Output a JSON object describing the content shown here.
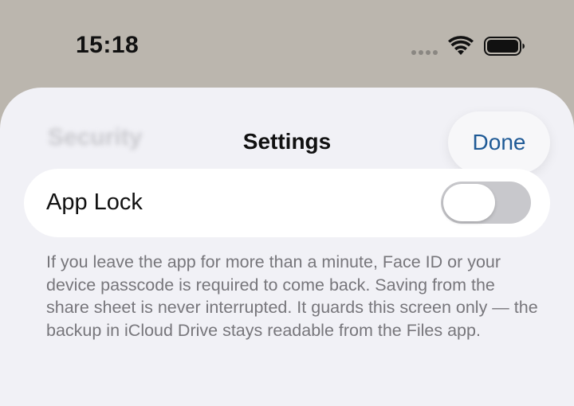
{
  "status_bar": {
    "time": "15:18",
    "icons": [
      "cellular-dots-icon",
      "wifi-icon",
      "battery-icon"
    ]
  },
  "sheet": {
    "nav": {
      "title": "Settings",
      "done_label": "Done"
    },
    "section_header": "Security",
    "app_lock": {
      "label": "App Lock",
      "enabled": false
    },
    "footer": "If you leave the app for more than a minute, Face ID or your device passcode is required to come back. Saving from the share sheet is never interrupted. It guards this screen only — the backup in iCloud Drive stays readable from the Files app."
  },
  "colors": {
    "backdrop": "#bbb6ae",
    "sheet_background": "#f1f1f6",
    "accent": "#1f5a96",
    "toggle_off": "#c8c8cc",
    "footer_text": "#77767b"
  }
}
